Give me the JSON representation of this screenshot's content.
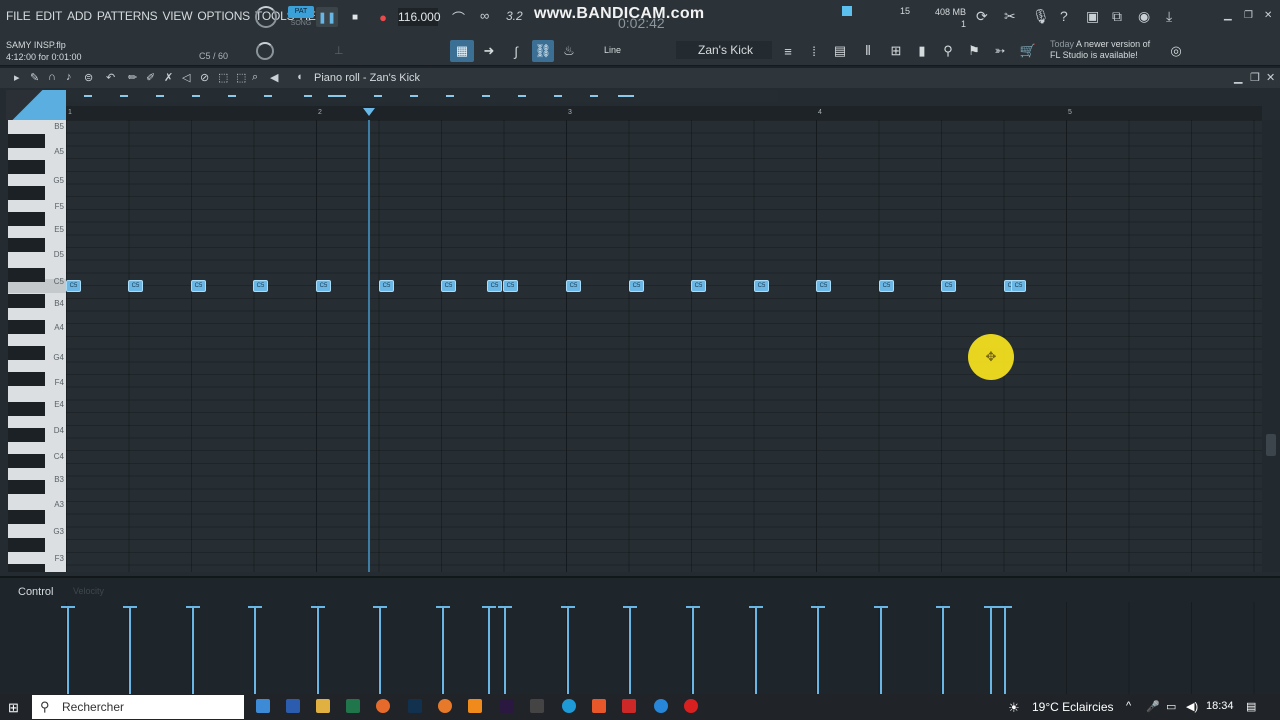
{
  "menu": [
    "FILE",
    "EDIT",
    "ADD",
    "PATTERNS",
    "VIEW",
    "OPTIONS",
    "TOOLS",
    "HELP"
  ],
  "transport": {
    "pat": "PAT",
    "song": "SONG",
    "tempo": "116.000",
    "time_sig": "3.2"
  },
  "watermark": "www.BANDICAM.com",
  "timecode": "0:02:42",
  "stats": {
    "cpu": "15",
    "memory": "408 MB",
    "poly": "1"
  },
  "project": {
    "name": "SAMY INSP.flp",
    "position": "4:12:00 for 0:01:00",
    "hint": "C5 / 60"
  },
  "snap": {
    "mode": "Line"
  },
  "channel": {
    "name": "Zan's Kick"
  },
  "news": {
    "day": "Today",
    "text": "A newer version of",
    "text2": "FL Studio is available!"
  },
  "piano_roll": {
    "title": "Piano roll - Zan's Kick",
    "bars": [
      "1",
      "2",
      "3",
      "4",
      "5"
    ]
  },
  "keys": [
    "B5",
    "A5",
    "G5",
    "F5",
    "E5",
    "D5",
    "C5",
    "B4",
    "A4",
    "G4",
    "F4",
    "E4",
    "D4",
    "C4",
    "B3",
    "A3",
    "G3",
    "F3"
  ],
  "notes": [
    "C5",
    "C5",
    "C5",
    "C5",
    "C5",
    "C5",
    "C5",
    "C5",
    "C5",
    "C5",
    "C5",
    "C5",
    "C5",
    "C5",
    "C5",
    "C5",
    "C5",
    "C5"
  ],
  "control": {
    "label": "Control",
    "param": "Velocity"
  },
  "taskbar": {
    "search": "Rechercher",
    "weather": "19°C  Eclaircies",
    "clock": "18:34"
  },
  "colors": {
    "accent": "#6ab7e5",
    "cursor": "#f2de1e",
    "record": "#e84b4b"
  }
}
